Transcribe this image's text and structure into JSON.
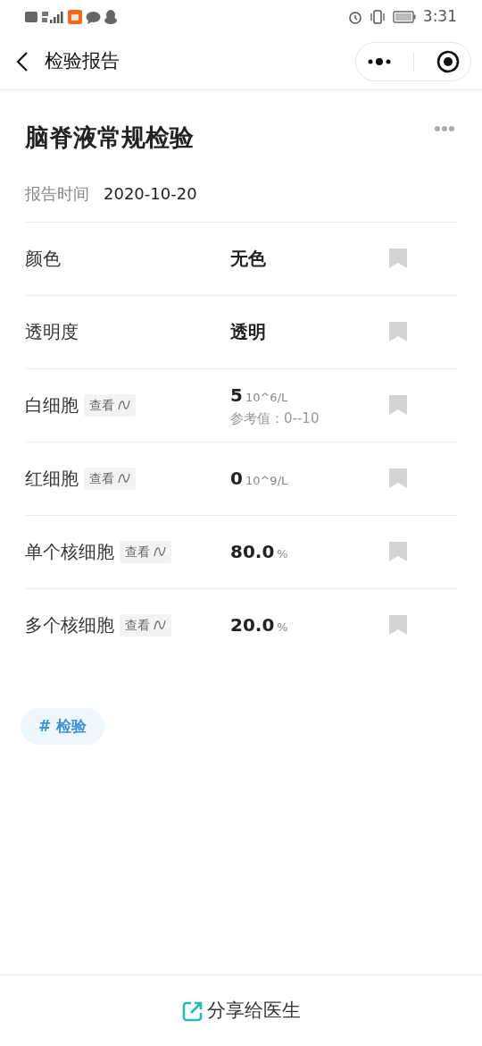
{
  "status_bar": {
    "time": "3:31"
  },
  "nav": {
    "title": "检验报告"
  },
  "report": {
    "title": "脑脊液常规检验",
    "time_label": "报告时间",
    "time": "2020-10-20"
  },
  "items": [
    {
      "name": "颜色",
      "value": "无色",
      "bookmarked": false
    },
    {
      "name": "透明度",
      "value": "透明",
      "bookmarked": false
    },
    {
      "name": "白细胞",
      "view": "查看",
      "value": "5",
      "unit": "10^6/L",
      "reference": "参考值：0--10",
      "bookmarked": false
    },
    {
      "name": "红细胞",
      "view": "查看",
      "value": "0",
      "unit": "10^9/L",
      "bookmarked": false
    },
    {
      "name": "单个核细胞",
      "view": "查看",
      "value": "80.0",
      "unit": "%",
      "bookmarked": false
    },
    {
      "name": "多个核细胞",
      "view": "查看",
      "value": "20.0",
      "unit": "%",
      "bookmarked": false
    }
  ],
  "tags": [
    "# 检验"
  ],
  "footer": {
    "share": "分享给医生"
  }
}
